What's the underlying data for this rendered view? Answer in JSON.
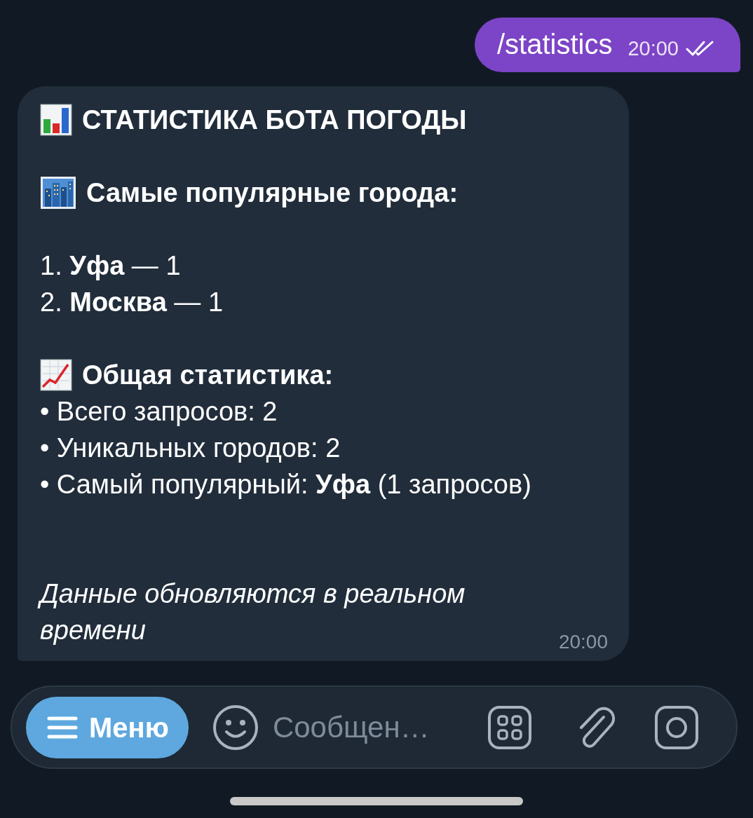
{
  "outgoing": {
    "text": "/statistics",
    "time": "20:00",
    "read": true
  },
  "incoming": {
    "title": "СТАТИСТИКА БОТА ПОГОДЫ",
    "sections": [
      {
        "kind": "cities",
        "heading": "Самые популярные города:",
        "lines": [
          "1. **Уфа** — 1",
          "2. **Москва** — 1"
        ]
      },
      {
        "kind": "totals",
        "heading": "Общая статистика:",
        "lines": [
          "• Всего запросов: 2",
          "• Уникальных городов: 2",
          "• Самый популярный: **Уфа** (1 запросов)"
        ]
      }
    ],
    "footer": "Данные обновляются в реальном времени",
    "time": "20:00"
  },
  "composer": {
    "menu_button": "Меню",
    "placeholder": "Сообщен…"
  }
}
